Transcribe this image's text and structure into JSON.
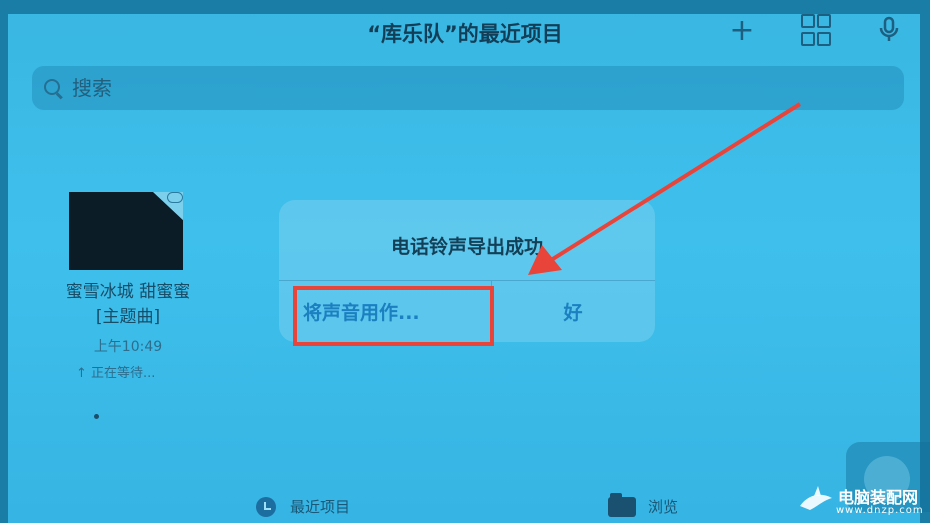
{
  "nav": {
    "title": "“库乐队”的最近项目",
    "add_label": "+",
    "grid_icon": "grid-view-icon",
    "mic_icon": "microphone-icon"
  },
  "search": {
    "placeholder": "搜索",
    "icon": "search-icon"
  },
  "file": {
    "name": "蜜雪冰城 甜蜜蜜 [主题曲]",
    "time": "上午10:49",
    "status": "↑ 正在等待..."
  },
  "alert": {
    "title": "电话铃声导出成功",
    "use_sound_label": "将声音用作...",
    "ok_label": "好"
  },
  "tabs": [
    {
      "label": "最近项目",
      "icon": "clock-icon"
    },
    {
      "label": "浏览",
      "icon": "folder-icon"
    }
  ],
  "watermark": {
    "text": "电脑装配网",
    "sub": "www.dnzp.com"
  },
  "colors": {
    "background": "#3fc0ec",
    "accent": "#1b7fc0",
    "highlight": "#e8443a"
  }
}
